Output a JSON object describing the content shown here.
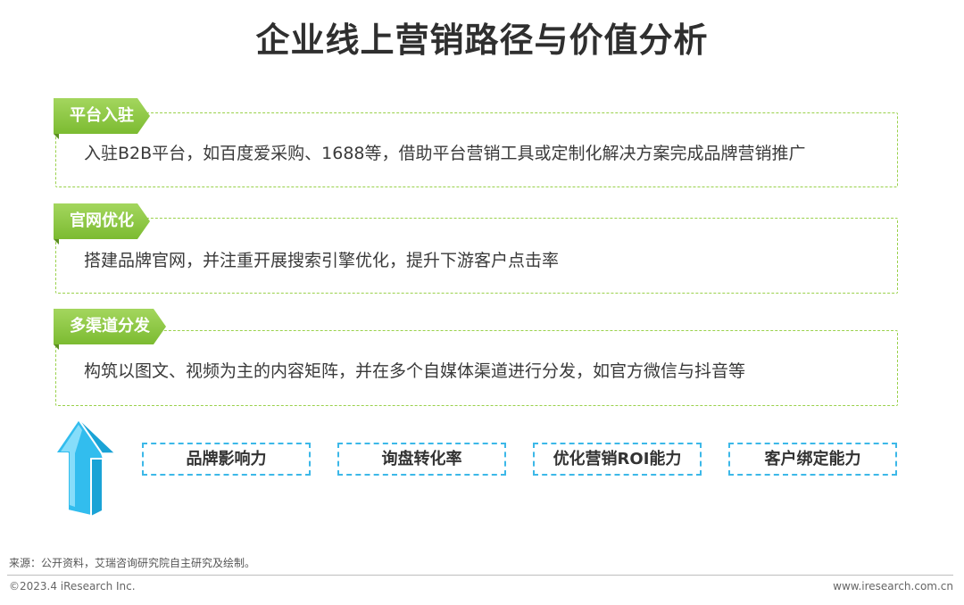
{
  "title": "企业线上营销路径与价值分析",
  "sections": [
    {
      "tag": "平台入驻",
      "text": "入驻B2B平台，如百度爱采购、1688等，借助平台营销工具或定制化解决方案完成品牌营销推广"
    },
    {
      "tag": "官网优化",
      "text": "搭建品牌官网，并注重开展搜索引擎优化，提升下游客户点击率"
    },
    {
      "tag": "多渠道分发",
      "text": "构筑以图文、视频为主的内容矩阵，并在多个自媒体渠道进行分发，如官方微信与抖音等"
    }
  ],
  "capabilities": [
    "品牌影响力",
    "询盘转化率",
    "优化营销ROI能力",
    "客户绑定能力"
  ],
  "arrow_icon": "up-arrow-icon",
  "colors": {
    "tag_green": "#8cc63f",
    "dashed_green": "#9ad14b",
    "dashed_blue": "#3cb8e8",
    "arrow_blue": "#29b6e8"
  },
  "footer": {
    "source": "来源：公开资料，艾瑞咨询研究院自主研究及绘制。",
    "copyright": "©2023.4 iResearch Inc.",
    "site": "www.iresearch.com.cn"
  }
}
